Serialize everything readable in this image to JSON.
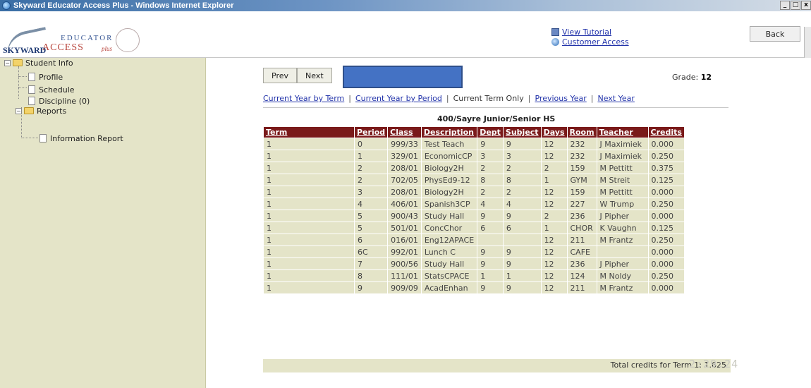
{
  "window": {
    "title": "Skyward Educator Access Plus - Windows Internet Explorer",
    "controls": [
      "_",
      "□",
      "x"
    ]
  },
  "header": {
    "logo": {
      "sky": "SKYWARD",
      "educator": "EDUCATOR",
      "access": "ACCESS",
      "plus": "plus"
    },
    "links": {
      "tutorial": "View Tutorial",
      "customer": "Customer Access"
    },
    "back_label": "Back"
  },
  "sidebar": {
    "student_info": "Student Info",
    "profile": "Profile",
    "schedule": "Schedule",
    "discipline": "Discipline (0)",
    "reports": "Reports",
    "information_report": "Information Report"
  },
  "nav": {
    "prev": "Prev",
    "next": "Next"
  },
  "grade": {
    "label": "Grade:",
    "value": "12"
  },
  "view_links": {
    "year_by_term": "Current Year by Term",
    "year_by_period": "Current Year by Period",
    "term_only": "Current Term Only",
    "previous_year": "Previous Year",
    "next_year": "Next Year",
    "sep": "|"
  },
  "school": "400/Sayre Junior/Senior HS",
  "table": {
    "headers": [
      "Term",
      "Period",
      "Class",
      "Description",
      "Dept",
      "Subject",
      "Days",
      "Room",
      "Teacher",
      "Credits"
    ],
    "rows": [
      [
        "1",
        "0",
        "999/33",
        "Test Teach",
        "9",
        "9",
        "12",
        "232",
        "J Maximiek",
        "0.000"
      ],
      [
        "1",
        "1",
        "329/01",
        "EconomicCP",
        "3",
        "3",
        "12",
        "232",
        "J Maximiek",
        "0.250"
      ],
      [
        "1",
        "2",
        "208/01",
        "Biology2H",
        "2",
        "2",
        "2",
        "159",
        "M Pettitt",
        "0.375"
      ],
      [
        "1",
        "2",
        "702/05",
        "PhysEd9-12",
        "8",
        "8",
        "1",
        "GYM",
        "M Streit",
        "0.125"
      ],
      [
        "1",
        "3",
        "208/01",
        "Biology2H",
        "2",
        "2",
        "12",
        "159",
        "M Pettitt",
        "0.000"
      ],
      [
        "1",
        "4",
        "406/01",
        "Spanish3CP",
        "4",
        "4",
        "12",
        "227",
        "W Trump",
        "0.250"
      ],
      [
        "1",
        "5",
        "900/43",
        "Study Hall",
        "9",
        "9",
        "2",
        "236",
        "J Pipher",
        "0.000"
      ],
      [
        "1",
        "5",
        "501/01",
        "ConcChor",
        "6",
        "6",
        "1",
        "CHOR",
        "K Vaughn",
        "0.125"
      ],
      [
        "1",
        "6",
        "016/01",
        "Eng12APACE",
        "",
        "",
        "12",
        "211",
        "M Frantz",
        "0.250"
      ],
      [
        "1",
        "6C",
        "992/01",
        "Lunch C",
        "9",
        "9",
        "12",
        "CAFE",
        "",
        "0.000"
      ],
      [
        "1",
        "7",
        "900/56",
        "Study Hall",
        "9",
        "9",
        "12",
        "236",
        "J Pipher",
        "0.000"
      ],
      [
        "1",
        "8",
        "111/01",
        "StatsCPACE",
        "1",
        "1",
        "12",
        "124",
        "M Noldy",
        "0.250"
      ],
      [
        "1",
        "9",
        "909/09",
        "AcadEnhan",
        "9",
        "9",
        "12",
        "211",
        "M Frantz",
        "0.000"
      ]
    ],
    "total": "Total credits for Term 1: 1.625"
  },
  "watermark": "2:29:24",
  "colors": {
    "header_maroon": "#7a1a1a",
    "row_tan": "#e4e4c8",
    "link_blue": "#2233aa",
    "redaction": "#4472c4"
  }
}
